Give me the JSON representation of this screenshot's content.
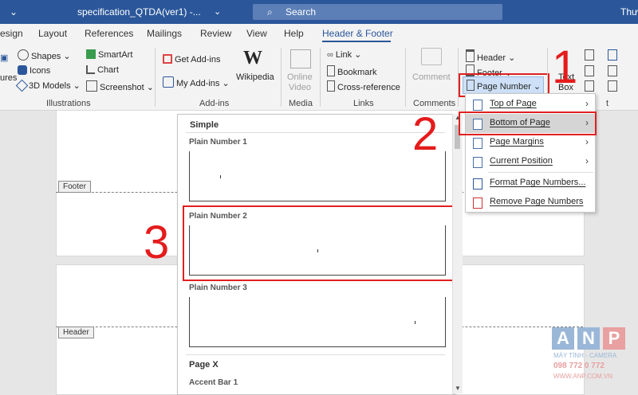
{
  "titlebar": {
    "filename": "specification_QTDA(ver1)  -...",
    "search": "Search",
    "user": "Thư"
  },
  "tabs": [
    "esign",
    "Layout",
    "References",
    "Mailings",
    "Review",
    "View",
    "Help",
    "Header & Footer"
  ],
  "ribbon": {
    "left_cut": "ures",
    "illustrations": {
      "shapes": "Shapes",
      "icons": "Icons",
      "models": "3D Models",
      "smartart": "SmartArt",
      "chart": "Chart",
      "screenshot": "Screenshot",
      "group": "Illustrations"
    },
    "addins": {
      "get": "Get Add-ins",
      "my": "My Add-ins",
      "wikipedia": "Wikipedia",
      "group": "Add-ins"
    },
    "media": {
      "online": "Online",
      "video": "Video",
      "group": "Media"
    },
    "links": {
      "link": "Link",
      "bookmark": "Bookmark",
      "crossref": "Cross-reference",
      "group": "Links"
    },
    "comments": {
      "comment": "Comment",
      "group": "Comments"
    },
    "hf": {
      "header": "Header",
      "footer": "Footer",
      "pagenumber": "Page Number"
    },
    "text": {
      "label1": "Text",
      "label2": "Box",
      "group": "t"
    }
  },
  "document": {
    "footer_tag": "Footer",
    "header_tag": "Header"
  },
  "gallery": {
    "section1": "Simple",
    "items": [
      "Plain Number 1",
      "Plain Number 2",
      "Plain Number 3"
    ],
    "section2": "Page X",
    "item4": "Accent Bar 1"
  },
  "menu": {
    "items": [
      {
        "label": "Top of Page",
        "arrow": "›"
      },
      {
        "label": "Bottom of Page",
        "arrow": "›"
      },
      {
        "label": "Page Margins",
        "arrow": "›"
      },
      {
        "label": "Current Position",
        "arrow": "›"
      },
      {
        "label": "Format Page Numbers...",
        "arrow": ""
      },
      {
        "label": "Remove Page Numbers",
        "arrow": ""
      }
    ]
  },
  "annotations": {
    "n1": "1",
    "n2": "2",
    "n3": "3"
  },
  "logo": {
    "a": "A",
    "n": "N",
    "p": "P",
    "line1": "MÁY TÍNH - CAMERA",
    "line2": "098 772 0 772",
    "line3": "WWW.ANP.COM.VN"
  },
  "colors": {
    "brand": "#2b579a",
    "annotation": "#e02020"
  }
}
